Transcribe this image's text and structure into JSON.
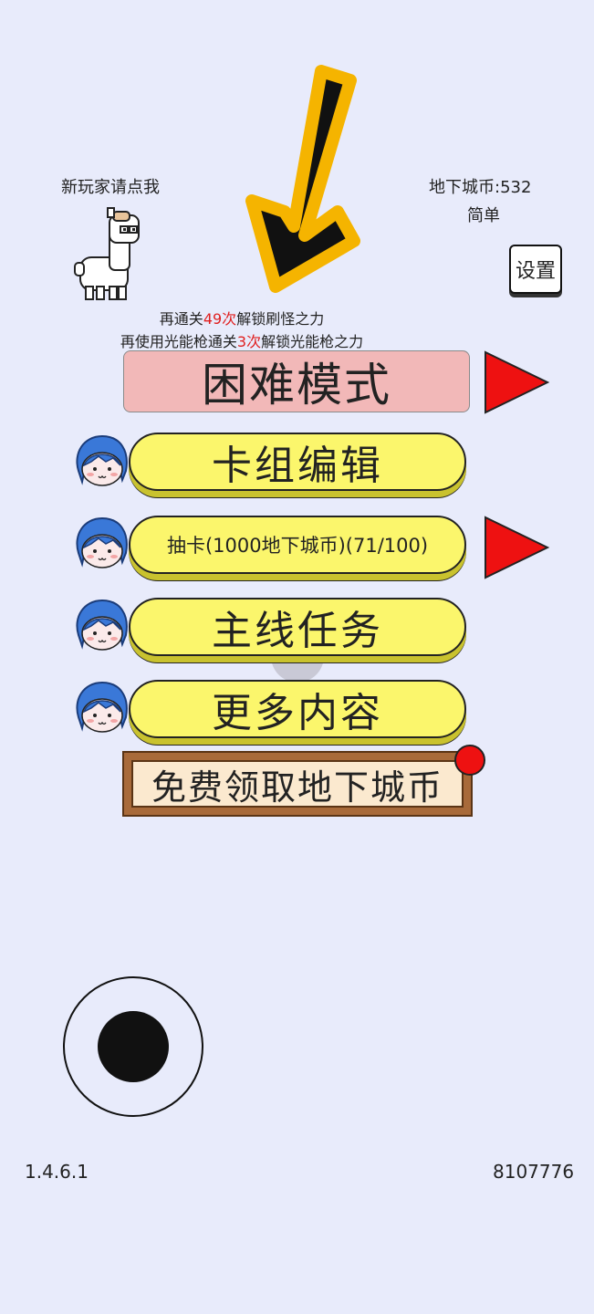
{
  "header": {
    "newbie_label": "新玩家请点我",
    "currency_label": "地下城币:532",
    "difficulty_label": "简单",
    "settings_label": "设置"
  },
  "hints": {
    "line1": {
      "pre": "再通关",
      "count": "49次",
      "post": "解锁刷怪之力"
    },
    "line2": {
      "pre": "再使用光能枪通关",
      "count": "3次",
      "post": "解锁光能枪之力"
    }
  },
  "menu": {
    "hard_mode": "困难模式",
    "deck_edit": "卡组编辑",
    "draw_card": "抽卡(1000地下城币)(71/100)",
    "main_quest": "主线任务",
    "more_content": "更多内容",
    "free_coins": "免费领取地下城币"
  },
  "footer": {
    "version": "1.4.6.1",
    "id": "8107776"
  },
  "colors": {
    "background": "#e8ebfb",
    "pill_yellow": "#fbf66c",
    "hard_pink": "#f2b8b8",
    "arrow_red": "#ee1111",
    "tutorial_arrow_border": "#f5b400"
  },
  "icons": {
    "tutorial_arrow": "down-left-arrow-icon",
    "alpaca": "alpaca-sprite",
    "face": "blue-hair-face-icon",
    "play_arrow": "red-triangle-right-icon"
  }
}
